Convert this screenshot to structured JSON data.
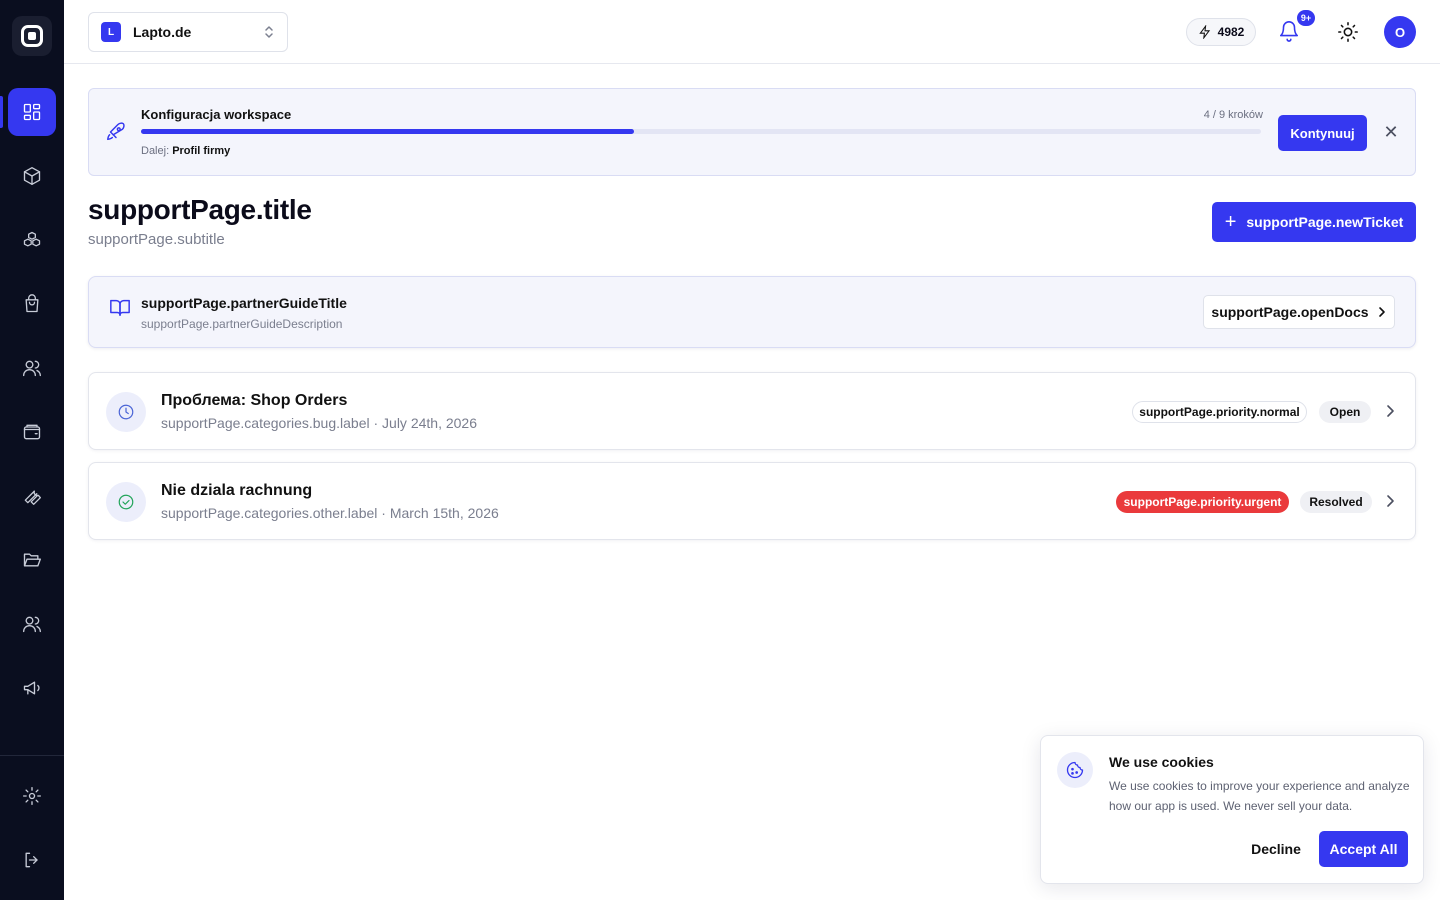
{
  "workspace": {
    "badge": "L",
    "name": "Lapto.de"
  },
  "topbar": {
    "credits": "4982",
    "notifications_badge": "9+",
    "avatar_initial": "O"
  },
  "setup": {
    "title": "Konfiguracja workspace",
    "steps": "4 / 9 kroków",
    "progress": 0.44,
    "next_label": "Dalej:",
    "next_value": "Profil firmy",
    "continue_label": "Kontynuuj",
    "close_symbol": "✕"
  },
  "page": {
    "title": "supportPage.title",
    "subtitle": "supportPage.subtitle",
    "new_ticket_label": "supportPage.newTicket"
  },
  "guide": {
    "title": "supportPage.partnerGuideTitle",
    "description": "supportPage.partnerGuideDescription",
    "open_docs_label": "supportPage.openDocs"
  },
  "tickets": [
    {
      "title": "Проблема: Shop Orders",
      "meta": "supportPage.categories.bug.label · July 24th, 2026",
      "priority": "supportPage.priority.normal",
      "status": "Open",
      "icon": "clock-icon"
    },
    {
      "title": "Nie dziala rachnung",
      "meta": "supportPage.categories.other.label · March 15th, 2026",
      "priority": "supportPage.priority.urgent",
      "status": "Resolved",
      "icon": "check-circle-icon"
    }
  ],
  "cookie": {
    "title": "We use cookies",
    "text": "We use cookies to improve your experience and analyze how our app is used. We never sell your data.",
    "decline_label": "Decline",
    "accept_label": "Accept All"
  },
  "colors": {
    "accent": "#3538f0",
    "sidebar": "#0a0e1f",
    "urgent": "#ea3a3c"
  }
}
